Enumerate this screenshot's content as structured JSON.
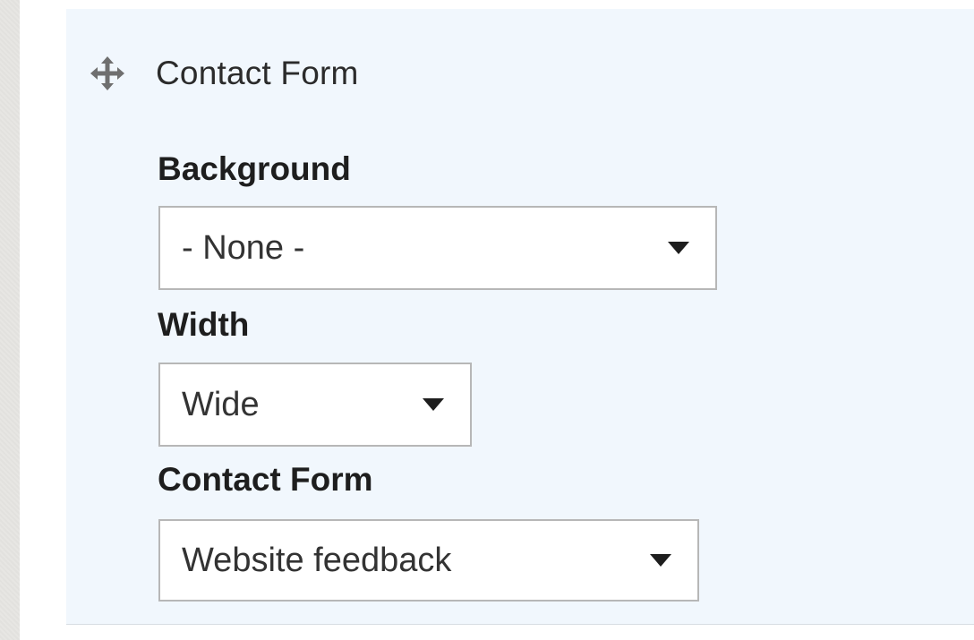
{
  "block": {
    "title": "Contact Form",
    "drag_icon": "move-arrows-icon"
  },
  "fields": {
    "background": {
      "label": "Background",
      "value": "- None -"
    },
    "width": {
      "label": "Width",
      "value": "Wide"
    },
    "contact_form": {
      "label": "Contact Form",
      "value": "Website feedback"
    }
  },
  "colors": {
    "panel_bg": "#f1f7fd",
    "select_border": "#b7b7b7",
    "text": "#333333"
  }
}
